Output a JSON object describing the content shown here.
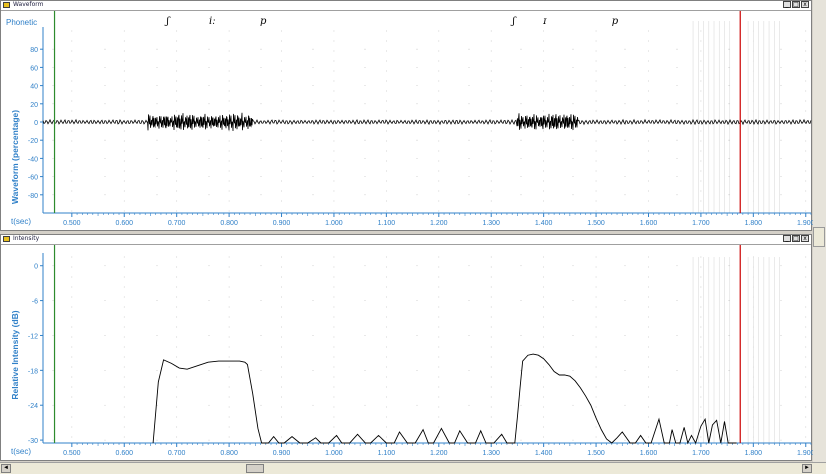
{
  "top_window": {
    "title": "Waveform",
    "phonetic_label": "Phonetic",
    "y_axis_label": "Waveform (percentage)",
    "x_axis_label": "t(sec)",
    "window_buttons": [
      "_",
      "□",
      "x"
    ],
    "phonetic_symbols": [
      {
        "symbol": "ʃ",
        "t": 0.683
      },
      {
        "symbol": "iː",
        "t": 0.768
      },
      {
        "symbol": "p",
        "t": 0.865
      },
      {
        "symbol": "ʃ",
        "t": 1.343
      },
      {
        "symbol": "ɪ",
        "t": 1.402
      },
      {
        "symbol": "p",
        "t": 1.536
      }
    ]
  },
  "bottom_window": {
    "title": "Intensity",
    "y_axis_label": "Relative Intensity (dB)",
    "x_axis_label": "t(sec)",
    "window_buttons": [
      "_",
      "□",
      "x"
    ]
  },
  "markers": {
    "start_t": 0.467,
    "cursor_t": 1.775,
    "start_color": "#2e8b2e",
    "cursor_color": "#cc0000"
  },
  "chart_data": [
    {
      "type": "line",
      "series_label": "Waveform",
      "ylabel": "Waveform (percentage)",
      "xlabel": "t(sec)",
      "xlim": [
        0.445,
        1.91
      ],
      "ylim": [
        -100,
        100
      ],
      "x_ticks": [
        "0.500",
        "0.600",
        "0.700",
        "0.800",
        "0.900",
        "1.000",
        "1.100",
        "1.200",
        "1.300",
        "1.400",
        "1.500",
        "1.600",
        "1.700",
        "1.800",
        "1.900"
      ],
      "y_ticks": [
        "80",
        "60",
        "40",
        "20",
        "0",
        "-20",
        "-40",
        "-60",
        "-80"
      ],
      "bursts": [
        {
          "t_start": 0.643,
          "t_end": 0.845,
          "amplitude": 12
        },
        {
          "t_start": 1.348,
          "t_end": 1.465,
          "amplitude": 12
        }
      ],
      "baseline_amplitude": 2.5
    },
    {
      "type": "line",
      "series_label": "Relative Intensity",
      "ylabel": "Relative Intensity (dB)",
      "xlabel": "t(sec)",
      "xlim": [
        0.445,
        1.91
      ],
      "ylim": [
        -30.5,
        1.5
      ],
      "x_ticks": [
        "0.500",
        "0.600",
        "0.700",
        "0.800",
        "0.900",
        "1.000",
        "1.100",
        "1.200",
        "1.300",
        "1.400",
        "1.500",
        "1.600",
        "1.700",
        "1.800",
        "1.900"
      ],
      "y_ticks": [
        "0",
        "-6",
        "-12",
        "-18",
        "-24",
        "-30"
      ],
      "x": [
        0.655,
        0.665,
        0.675,
        0.69,
        0.705,
        0.72,
        0.74,
        0.76,
        0.78,
        0.8,
        0.82,
        0.83,
        0.835,
        0.845,
        0.855,
        0.862,
        0.868,
        0.875,
        0.885,
        0.895,
        0.905,
        0.92,
        0.935,
        0.95,
        0.965,
        0.975,
        0.99,
        1.005,
        1.015,
        1.03,
        1.045,
        1.06,
        1.07,
        1.085,
        1.1,
        1.115,
        1.125,
        1.14,
        1.155,
        1.17,
        1.18,
        1.19,
        1.205,
        1.22,
        1.23,
        1.24,
        1.255,
        1.27,
        1.28,
        1.29,
        1.305,
        1.32,
        1.33,
        1.34,
        1.345,
        1.35,
        1.355,
        1.36,
        1.37,
        1.38,
        1.39,
        1.4,
        1.41,
        1.42,
        1.43,
        1.44,
        1.45,
        1.46,
        1.47,
        1.48,
        1.49,
        1.5,
        1.51,
        1.52,
        1.53,
        1.54,
        1.55,
        1.565,
        1.575,
        1.585,
        1.595,
        1.605,
        1.62,
        1.63,
        1.64,
        1.645,
        1.652,
        1.66,
        1.668,
        1.675,
        1.682,
        1.69,
        1.7,
        1.708,
        1.715,
        1.722,
        1.73,
        1.738,
        1.745,
        1.752,
        1.76,
        1.768
      ],
      "y": [
        -30.5,
        -20,
        -16.2,
        -16.8,
        -17.6,
        -17.8,
        -17.2,
        -16.6,
        -16.4,
        -16.4,
        -16.4,
        -16.6,
        -17,
        -22,
        -28,
        -30.5,
        -30.5,
        -30.5,
        -29.4,
        -30.5,
        -30.5,
        -29.4,
        -30.5,
        -30.5,
        -29.6,
        -30.5,
        -30.5,
        -29.2,
        -30.5,
        -30.5,
        -29,
        -30.5,
        -30.5,
        -29.2,
        -30.5,
        -30.5,
        -28.6,
        -30.5,
        -30.5,
        -28.2,
        -30.5,
        -30.5,
        -28,
        -30.5,
        -30.5,
        -28.4,
        -30.5,
        -30.5,
        -28.4,
        -30.5,
        -30.5,
        -29,
        -30.5,
        -30.5,
        -30.5,
        -26,
        -21,
        -16.4,
        -15.4,
        -15.2,
        -15.4,
        -16,
        -17,
        -18.2,
        -18.8,
        -18.8,
        -19,
        -19.8,
        -21,
        -22.4,
        -24,
        -26.2,
        -28.2,
        -29.8,
        -30.5,
        -29.6,
        -28.6,
        -30.5,
        -30.5,
        -29.2,
        -30.5,
        -30.5,
        -26.4,
        -30.5,
        -30.5,
        -28.2,
        -30.5,
        -30.5,
        -27.8,
        -30.5,
        -29.2,
        -30.5,
        -27.6,
        -26.4,
        -30.5,
        -27.4,
        -26.6,
        -30.5,
        -26.8,
        -30.5,
        -30.5,
        -30.5
      ]
    }
  ]
}
